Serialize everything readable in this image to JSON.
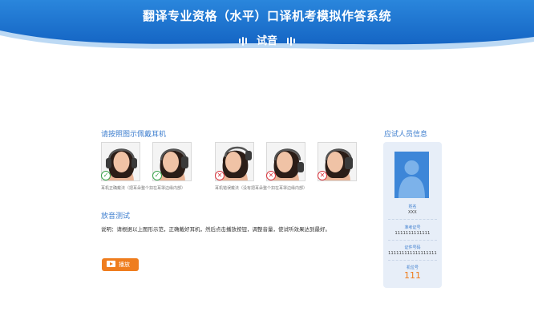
{
  "header": {
    "title": "翻译专业资格（水平）口译机考模拟作答系统",
    "mode_label": "试音"
  },
  "headphones": {
    "title": "请按照图示佩戴耳机",
    "correct_caption": "耳机正确戴法（把耳朵整个扣在耳罩边缘内部）",
    "wrong_caption": "耳机错误戴法（没有把耳朵整个扣在耳罩边缘内部）",
    "photos": [
      {
        "status": "correct",
        "icon": "check-icon"
      },
      {
        "status": "correct",
        "icon": "check-icon"
      },
      {
        "status": "wrong",
        "icon": "cross-icon"
      },
      {
        "status": "wrong",
        "icon": "cross-icon"
      },
      {
        "status": "wrong",
        "icon": "cross-icon"
      }
    ]
  },
  "sound_test": {
    "title": "放音测试",
    "instruction": "说明：请根据以上图形示范，正确戴好耳机，然后点击播放按钮，调整音量，使试听效果达到最好。",
    "play_label": "播放"
  },
  "candidate": {
    "title": "应试人员信息",
    "name_label": "姓名",
    "name_value": "XXX",
    "exam_id_label": "准考证号",
    "exam_id_value": "1111111111111",
    "cert_id_label": "证件号码",
    "cert_id_value": "111111111111111111",
    "seat_label": "机位号",
    "seat_value": "111"
  },
  "colors": {
    "header_blue": "#1f7fd6",
    "accent_blue": "#3f7fcf",
    "orange": "#ef7d1e",
    "correct_green": "#38a34a",
    "wrong_red": "#d9363e"
  }
}
